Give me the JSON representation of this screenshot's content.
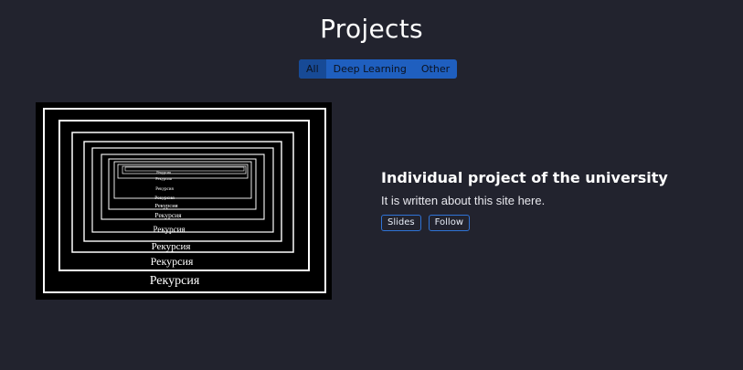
{
  "header": {
    "title": "Projects"
  },
  "filters": [
    {
      "label": "All",
      "active": true
    },
    {
      "label": "Deep Learning",
      "active": false
    },
    {
      "label": "Other",
      "active": false
    }
  ],
  "project": {
    "image_caption": "Рекурсия",
    "title": "Individual project of the university",
    "description": "It is written about this site here.",
    "buttons": {
      "slides": "Slides",
      "follow": "Follow"
    }
  },
  "colors": {
    "background": "#22232e",
    "accent": "#1f5fbf",
    "accent_active": "#174a96",
    "button_border": "#2f73d6"
  }
}
